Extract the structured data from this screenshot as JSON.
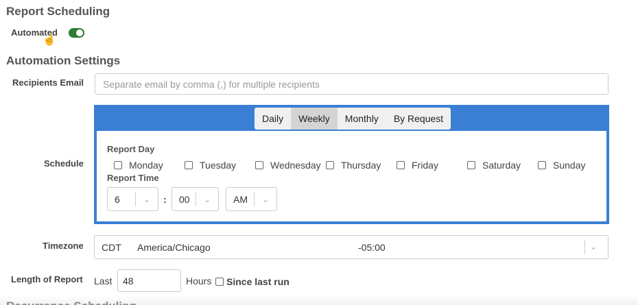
{
  "report_scheduling": {
    "title": "Report Scheduling",
    "automated_label": "Automated",
    "automated_on": true
  },
  "automation_settings": {
    "title": "Automation Settings",
    "recipients_label": "Recipients Email",
    "recipients_placeholder": "Separate email by comma (,) for multiple recipients",
    "recipients_value": ""
  },
  "schedule": {
    "label": "Schedule",
    "tabs": [
      {
        "label": "Daily",
        "active": false
      },
      {
        "label": "Weekly",
        "active": true
      },
      {
        "label": "Monthly",
        "active": false
      },
      {
        "label": "By Request",
        "active": false
      }
    ],
    "report_day_label": "Report Day",
    "days": [
      {
        "label": "Monday",
        "checked": false
      },
      {
        "label": "Tuesday",
        "checked": false
      },
      {
        "label": "Wednesday",
        "checked": false
      },
      {
        "label": "Thursday",
        "checked": false
      },
      {
        "label": "Friday",
        "checked": false
      },
      {
        "label": "Saturday",
        "checked": false
      },
      {
        "label": "Sunday",
        "checked": false
      }
    ],
    "report_time_label": "Report Time",
    "hour": "6",
    "minute": "00",
    "ampm": "AM",
    "colon": ":"
  },
  "timezone": {
    "label": "Timezone",
    "abbr": "CDT",
    "name": "America/Chicago",
    "offset": "-05:00"
  },
  "length": {
    "label": "Length of Report",
    "prefix": "Last",
    "value": "48",
    "unit": "Hours",
    "since_label": "Since last run",
    "since_checked": false
  },
  "next_section_partial": "Recurrence Scheduling",
  "icons": {
    "chevron": "chevron-down-icon",
    "cursor": "hand-pointer-icon"
  },
  "colors": {
    "toggle_on": "#2e7d32",
    "schedule_border": "#3a7fd4",
    "active_tab": "#d4d4d4"
  }
}
